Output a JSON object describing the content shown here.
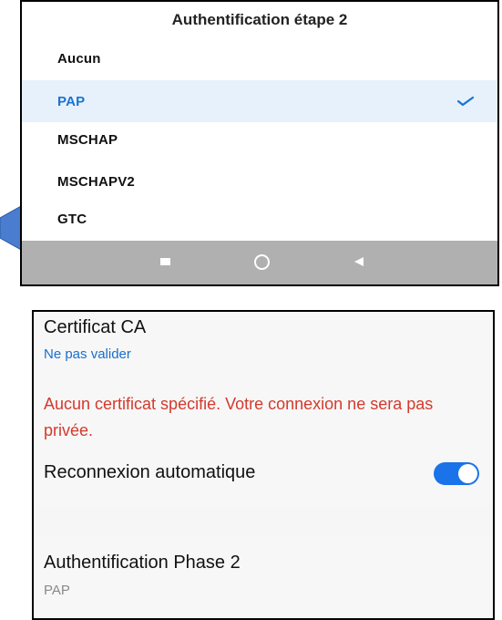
{
  "dialog": {
    "title": "Authentification étape 2",
    "options": [
      {
        "label": "Aucun",
        "selected": false
      },
      {
        "label": "PAP",
        "selected": true
      },
      {
        "label": "MSCHAP",
        "selected": false
      },
      {
        "label": "MSCHAPV2",
        "selected": false
      },
      {
        "label": "GTC",
        "selected": false
      }
    ],
    "check_icon": "checkmark-icon",
    "accent_color": "#1a73d0"
  },
  "navbar": {
    "icons": [
      "recent-apps-icon",
      "home-icon",
      "back-icon"
    ]
  },
  "settings": {
    "ca_certificate": {
      "label": "Certificat CA",
      "value": "Ne pas valider"
    },
    "warning": "Aucun certificat spécifié. Votre connexion ne sera pas privée.",
    "auto_reconnect": {
      "label": "Reconnexion automatique",
      "enabled": true
    },
    "phase2": {
      "label": "Authentification Phase 2",
      "value": "PAP"
    }
  },
  "colors": {
    "link": "#1a6ecc",
    "warning": "#d33a2c",
    "toggle_on": "#1a73e8",
    "selected_bg": "#e6f1fc"
  }
}
